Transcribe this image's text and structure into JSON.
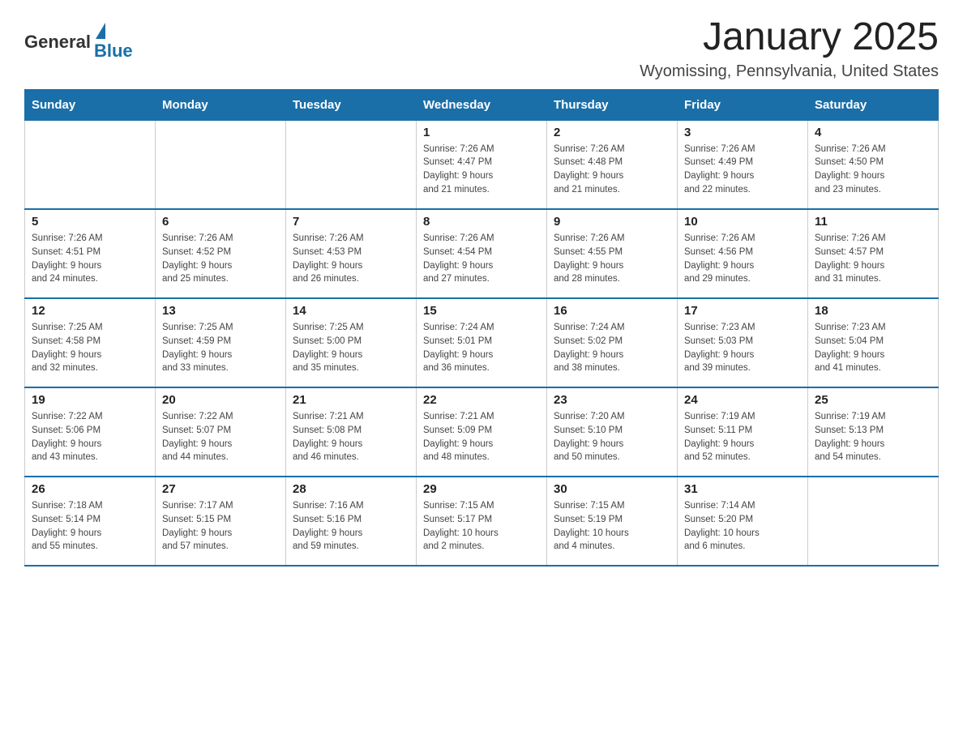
{
  "header": {
    "logo": {
      "text_general": "General",
      "text_blue": "Blue",
      "triangle_alt": "GeneralBlue logo"
    },
    "title": "January 2025",
    "subtitle": "Wyomissing, Pennsylvania, United States"
  },
  "weekdays": [
    "Sunday",
    "Monday",
    "Tuesday",
    "Wednesday",
    "Thursday",
    "Friday",
    "Saturday"
  ],
  "weeks": [
    [
      {
        "day": "",
        "info": ""
      },
      {
        "day": "",
        "info": ""
      },
      {
        "day": "",
        "info": ""
      },
      {
        "day": "1",
        "info": "Sunrise: 7:26 AM\nSunset: 4:47 PM\nDaylight: 9 hours\nand 21 minutes."
      },
      {
        "day": "2",
        "info": "Sunrise: 7:26 AM\nSunset: 4:48 PM\nDaylight: 9 hours\nand 21 minutes."
      },
      {
        "day": "3",
        "info": "Sunrise: 7:26 AM\nSunset: 4:49 PM\nDaylight: 9 hours\nand 22 minutes."
      },
      {
        "day": "4",
        "info": "Sunrise: 7:26 AM\nSunset: 4:50 PM\nDaylight: 9 hours\nand 23 minutes."
      }
    ],
    [
      {
        "day": "5",
        "info": "Sunrise: 7:26 AM\nSunset: 4:51 PM\nDaylight: 9 hours\nand 24 minutes."
      },
      {
        "day": "6",
        "info": "Sunrise: 7:26 AM\nSunset: 4:52 PM\nDaylight: 9 hours\nand 25 minutes."
      },
      {
        "day": "7",
        "info": "Sunrise: 7:26 AM\nSunset: 4:53 PM\nDaylight: 9 hours\nand 26 minutes."
      },
      {
        "day": "8",
        "info": "Sunrise: 7:26 AM\nSunset: 4:54 PM\nDaylight: 9 hours\nand 27 minutes."
      },
      {
        "day": "9",
        "info": "Sunrise: 7:26 AM\nSunset: 4:55 PM\nDaylight: 9 hours\nand 28 minutes."
      },
      {
        "day": "10",
        "info": "Sunrise: 7:26 AM\nSunset: 4:56 PM\nDaylight: 9 hours\nand 29 minutes."
      },
      {
        "day": "11",
        "info": "Sunrise: 7:26 AM\nSunset: 4:57 PM\nDaylight: 9 hours\nand 31 minutes."
      }
    ],
    [
      {
        "day": "12",
        "info": "Sunrise: 7:25 AM\nSunset: 4:58 PM\nDaylight: 9 hours\nand 32 minutes."
      },
      {
        "day": "13",
        "info": "Sunrise: 7:25 AM\nSunset: 4:59 PM\nDaylight: 9 hours\nand 33 minutes."
      },
      {
        "day": "14",
        "info": "Sunrise: 7:25 AM\nSunset: 5:00 PM\nDaylight: 9 hours\nand 35 minutes."
      },
      {
        "day": "15",
        "info": "Sunrise: 7:24 AM\nSunset: 5:01 PM\nDaylight: 9 hours\nand 36 minutes."
      },
      {
        "day": "16",
        "info": "Sunrise: 7:24 AM\nSunset: 5:02 PM\nDaylight: 9 hours\nand 38 minutes."
      },
      {
        "day": "17",
        "info": "Sunrise: 7:23 AM\nSunset: 5:03 PM\nDaylight: 9 hours\nand 39 minutes."
      },
      {
        "day": "18",
        "info": "Sunrise: 7:23 AM\nSunset: 5:04 PM\nDaylight: 9 hours\nand 41 minutes."
      }
    ],
    [
      {
        "day": "19",
        "info": "Sunrise: 7:22 AM\nSunset: 5:06 PM\nDaylight: 9 hours\nand 43 minutes."
      },
      {
        "day": "20",
        "info": "Sunrise: 7:22 AM\nSunset: 5:07 PM\nDaylight: 9 hours\nand 44 minutes."
      },
      {
        "day": "21",
        "info": "Sunrise: 7:21 AM\nSunset: 5:08 PM\nDaylight: 9 hours\nand 46 minutes."
      },
      {
        "day": "22",
        "info": "Sunrise: 7:21 AM\nSunset: 5:09 PM\nDaylight: 9 hours\nand 48 minutes."
      },
      {
        "day": "23",
        "info": "Sunrise: 7:20 AM\nSunset: 5:10 PM\nDaylight: 9 hours\nand 50 minutes."
      },
      {
        "day": "24",
        "info": "Sunrise: 7:19 AM\nSunset: 5:11 PM\nDaylight: 9 hours\nand 52 minutes."
      },
      {
        "day": "25",
        "info": "Sunrise: 7:19 AM\nSunset: 5:13 PM\nDaylight: 9 hours\nand 54 minutes."
      }
    ],
    [
      {
        "day": "26",
        "info": "Sunrise: 7:18 AM\nSunset: 5:14 PM\nDaylight: 9 hours\nand 55 minutes."
      },
      {
        "day": "27",
        "info": "Sunrise: 7:17 AM\nSunset: 5:15 PM\nDaylight: 9 hours\nand 57 minutes."
      },
      {
        "day": "28",
        "info": "Sunrise: 7:16 AM\nSunset: 5:16 PM\nDaylight: 9 hours\nand 59 minutes."
      },
      {
        "day": "29",
        "info": "Sunrise: 7:15 AM\nSunset: 5:17 PM\nDaylight: 10 hours\nand 2 minutes."
      },
      {
        "day": "30",
        "info": "Sunrise: 7:15 AM\nSunset: 5:19 PM\nDaylight: 10 hours\nand 4 minutes."
      },
      {
        "day": "31",
        "info": "Sunrise: 7:14 AM\nSunset: 5:20 PM\nDaylight: 10 hours\nand 6 minutes."
      },
      {
        "day": "",
        "info": ""
      }
    ]
  ]
}
